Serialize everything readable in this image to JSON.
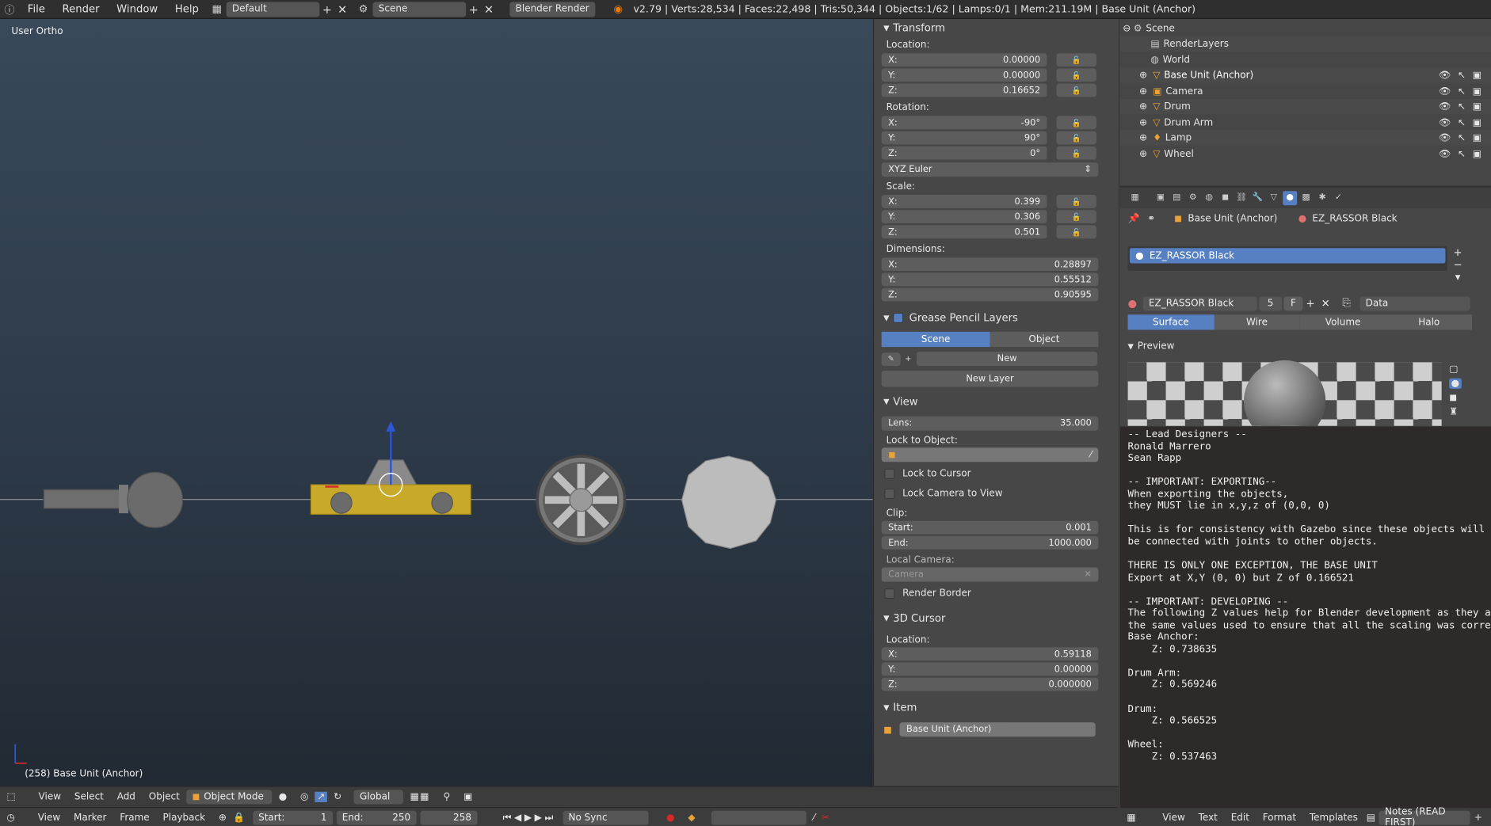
{
  "topbar": {
    "menus": [
      "File",
      "Render",
      "Window",
      "Help"
    ],
    "screen_layout": "Default",
    "scene": "Scene",
    "engine": "Blender Render",
    "status": "v2.79 | Verts:28,534 | Faces:22,498 | Tris:50,344 | Objects:1/62 | Lamps:0/1 | Mem:211.19M | Base Unit (Anchor)"
  },
  "viewport": {
    "view_label": "User Ortho",
    "status": "(258) Base Unit (Anchor)"
  },
  "npanel": {
    "transform_title": "Transform",
    "location_label": "Location:",
    "location": [
      {
        "axis": "X:",
        "value": "0.00000"
      },
      {
        "axis": "Y:",
        "value": "0.00000"
      },
      {
        "axis": "Z:",
        "value": "0.16652"
      }
    ],
    "rotation_label": "Rotation:",
    "rotation": [
      {
        "axis": "X:",
        "value": "-90°"
      },
      {
        "axis": "Y:",
        "value": "90°"
      },
      {
        "axis": "Z:",
        "value": "0°"
      }
    ],
    "rotation_mode": "XYZ Euler",
    "scale_label": "Scale:",
    "scale": [
      {
        "axis": "X:",
        "value": "0.399"
      },
      {
        "axis": "Y:",
        "value": "0.306"
      },
      {
        "axis": "Z:",
        "value": "0.501"
      }
    ],
    "dimensions_label": "Dimensions:",
    "dimensions": [
      {
        "axis": "X:",
        "value": "0.28897"
      },
      {
        "axis": "Y:",
        "value": "0.55512"
      },
      {
        "axis": "Z:",
        "value": "0.90595"
      }
    ],
    "grease_title": "Grease Pencil Layers",
    "grease_tabs": [
      "Scene",
      "Object"
    ],
    "grease_new": "New",
    "grease_new_layer": "New Layer",
    "view_title": "View",
    "lens_label": "Lens:",
    "lens_value": "35.000",
    "lock_to_object_label": "Lock to Object:",
    "lock_to_cursor": "Lock to Cursor",
    "lock_camera": "Lock Camera to View",
    "clip_label": "Clip:",
    "clip_start_label": "Start:",
    "clip_start": "0.001",
    "clip_end_label": "End:",
    "clip_end": "1000.000",
    "local_camera_label": "Local Camera:",
    "local_camera_placeholder": "Camera",
    "render_border": "Render Border",
    "cursor_title": "3D Cursor",
    "cursor_location_label": "Location:",
    "cursor_location": [
      {
        "axis": "X:",
        "value": "0.59118"
      },
      {
        "axis": "Y:",
        "value": "0.00000"
      },
      {
        "axis": "Z:",
        "value": "0.000000"
      }
    ],
    "item_title": "Item",
    "item_name": "Base Unit (Anchor)"
  },
  "outliner": {
    "rows": [
      {
        "label": "Scene",
        "icon": "scene-icon"
      },
      {
        "label": "RenderLayers",
        "icon": "renderlayers-icon"
      },
      {
        "label": "World",
        "icon": "world-icon"
      },
      {
        "label": "Base Unit (Anchor)",
        "icon": "mesh-icon"
      },
      {
        "label": "Camera",
        "icon": "camera-icon"
      },
      {
        "label": "Drum",
        "icon": "mesh-icon"
      },
      {
        "label": "Drum Arm",
        "icon": "mesh-icon"
      },
      {
        "label": "Lamp",
        "icon": "lamp-icon"
      },
      {
        "label": "Wheel",
        "icon": "mesh-icon"
      }
    ]
  },
  "properties": {
    "breadcrumb_object": "Base Unit (Anchor)",
    "breadcrumb_material": "EZ_RASSOR Black",
    "slot_name": "EZ_RASSOR Black",
    "material_name": "EZ_RASSOR Black",
    "users": "5",
    "fake_user": "F",
    "link": "Data",
    "shading_tabs": [
      "Surface",
      "Wire",
      "Volume",
      "Halo"
    ],
    "preview_title": "Preview"
  },
  "text_editor": {
    "lines": [
      "-- Lead Designers --",
      "Ronald Marrero",
      "Sean Rapp",
      "",
      "-- IMPORTANT: EXPORTING--",
      "When exporting the objects,",
      "they MUST lie in x,y,z of (0,0, 0)",
      "",
      "This is for consistency with Gazebo since these objects will",
      "be connected with joints to other objects.",
      "",
      "THERE IS ONLY ONE EXCEPTION, THE BASE UNIT",
      "Export at X,Y (0, 0) but Z of 0.166521",
      "",
      "-- IMPORTANT: DEVELOPING --",
      "The following Z values help for Blender development as they are",
      "the same values used to ensure that all the scaling was correct",
      "Base Anchor:",
      "    Z: 0.738635",
      "",
      "Drum Arm:",
      "    Z: 0.569246",
      "",
      "Drum:",
      "    Z: 0.566525",
      "",
      "Wheel:",
      "    Z: 0.537463"
    ],
    "menus": [
      "View",
      "Text",
      "Edit",
      "Format",
      "Templates"
    ],
    "file_name": "Notes (READ FIRST)"
  },
  "view3d_header": {
    "menus": [
      "View",
      "Select",
      "Add",
      "Object"
    ],
    "mode": "Object Mode",
    "orientation": "Global"
  },
  "timeline": {
    "menus": [
      "View",
      "Marker",
      "Frame",
      "Playback"
    ],
    "start_label": "Start:",
    "start": "1",
    "end_label": "End:",
    "end": "250",
    "current": "258",
    "sync": "No Sync"
  },
  "colors": {
    "accent": "#5680c2",
    "object_yellow": "#c8a92a",
    "text_bg": "#2f2a2a"
  }
}
